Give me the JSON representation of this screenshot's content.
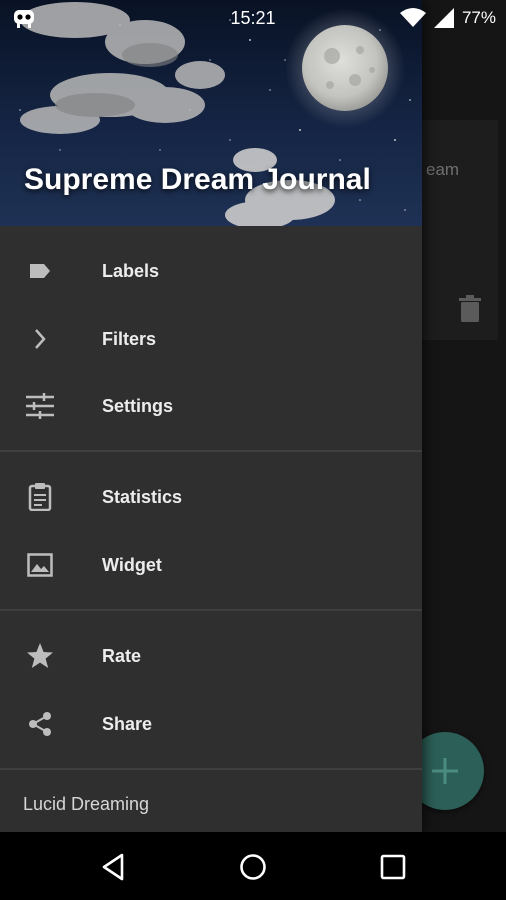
{
  "status_bar": {
    "time": "15:21",
    "battery": "77%",
    "icons": [
      "notification-bot-icon",
      "wifi-icon",
      "signal-icon"
    ]
  },
  "background_app": {
    "card_text": "eam",
    "fab_icon": "plus-icon"
  },
  "drawer": {
    "title": "Supreme Dream Journal",
    "sections": [
      [
        {
          "label": "Labels",
          "icon": "label-tag-icon"
        },
        {
          "label": "Filters",
          "icon": "chevron-right-icon"
        },
        {
          "label": "Settings",
          "icon": "sliders-icon"
        }
      ],
      [
        {
          "label": "Statistics",
          "icon": "clipboard-icon"
        },
        {
          "label": "Widget",
          "icon": "image-icon"
        }
      ],
      [
        {
          "label": "Rate",
          "icon": "star-icon"
        },
        {
          "label": "Share",
          "icon": "share-icon"
        }
      ]
    ],
    "footer_section_label": "Lucid Dreaming"
  },
  "nav_bar": {
    "buttons": [
      "back-icon",
      "home-icon",
      "recents-icon"
    ]
  },
  "colors": {
    "drawer_bg": "#2f2f2f",
    "divider": "#3f3f3f",
    "fab": "#2c5f57"
  }
}
